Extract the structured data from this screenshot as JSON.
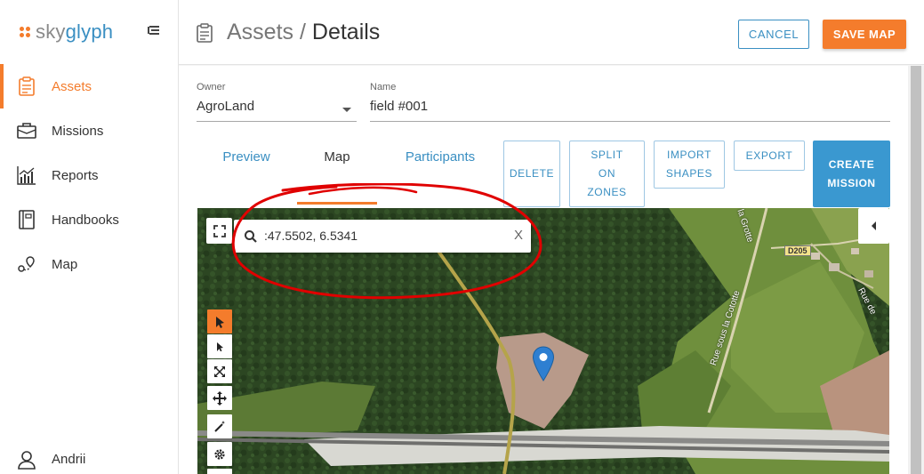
{
  "brand": {
    "name_part1": "sky",
    "name_part2": "glyph"
  },
  "sidebar": {
    "items": [
      {
        "label": "Assets",
        "icon": "clipboard-icon",
        "active": true
      },
      {
        "label": "Missions",
        "icon": "briefcase-icon",
        "active": false
      },
      {
        "label": "Reports",
        "icon": "chart-icon",
        "active": false
      },
      {
        "label": "Handbooks",
        "icon": "book-icon",
        "active": false
      },
      {
        "label": "Map",
        "icon": "map-route-icon",
        "active": false
      }
    ],
    "user": {
      "name": "Andrii",
      "icon": "user-icon"
    }
  },
  "header": {
    "crumb": "Assets",
    "separator": "/",
    "current": "Details",
    "cancel_label": "CANCEL",
    "save_label": "SAVE MAP"
  },
  "form": {
    "owner_label": "Owner",
    "owner_value": "AgroLand",
    "name_label": "Name",
    "name_value": "field #001"
  },
  "tabs": [
    {
      "label": "Preview",
      "active": false
    },
    {
      "label": "Map",
      "active": true
    },
    {
      "label": "Participants",
      "active": false
    }
  ],
  "actions": {
    "delete": [
      "DELETE"
    ],
    "split": [
      "SPLIT",
      "ON",
      "ZONES"
    ],
    "import": [
      "IMPORT",
      "SHAPES"
    ],
    "export": [
      "EXPORT"
    ],
    "create": [
      "CREATE",
      "MISSION"
    ]
  },
  "map": {
    "search_value": ":47.5502, 6.5341",
    "search_clear": "X",
    "road_label": "D205",
    "street_labels": [
      "Rue sous la Cototte",
      "Rue de",
      "la Grotte"
    ],
    "tools": [
      "select-arrow-icon",
      "direct-select-icon",
      "resize-icon",
      "move-icon",
      "magic-wand-icon",
      "settings-gear-icon"
    ]
  },
  "colors": {
    "accent": "#f47c2c",
    "primary": "#3a8fc2",
    "annotation": "#e00000"
  }
}
